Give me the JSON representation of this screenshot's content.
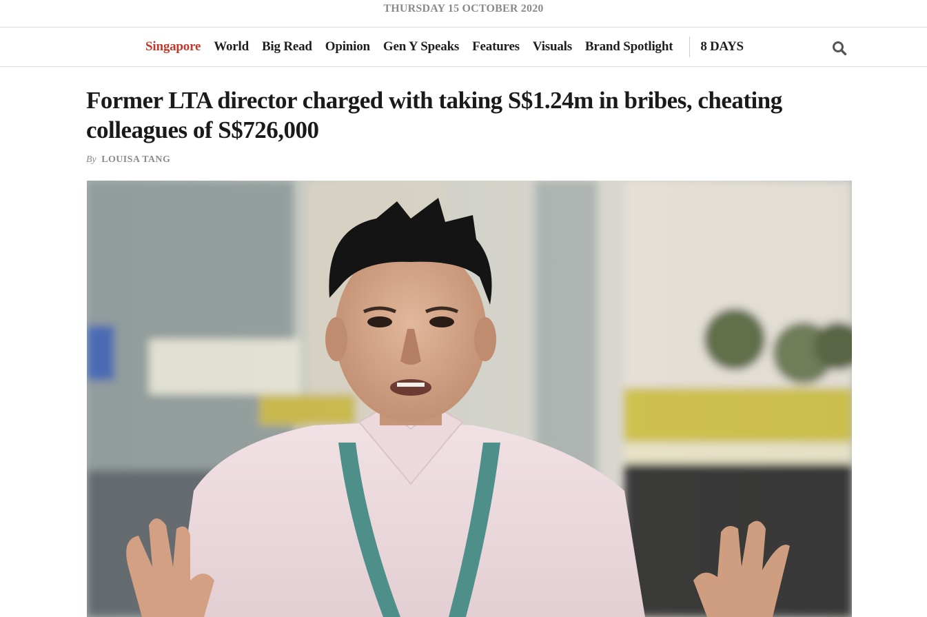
{
  "dateline": "THURSDAY 15 OCTOBER 2020",
  "nav": {
    "items": [
      {
        "label": "Singapore",
        "active": true
      },
      {
        "label": "World"
      },
      {
        "label": "Big Read"
      },
      {
        "label": "Opinion"
      },
      {
        "label": "Gen Y Speaks"
      },
      {
        "label": "Features"
      },
      {
        "label": "Visuals"
      },
      {
        "label": "Brand Spotlight"
      }
    ],
    "secondary": "8 DAYS",
    "search_icon": "search-icon",
    "active_color": "#c0392b"
  },
  "article": {
    "headline": "Former LTA director charged with taking S$1.24m in bribes, cheating colleagues of S$726,000",
    "byline_prefix": "By",
    "author": "LOUISA TANG"
  }
}
